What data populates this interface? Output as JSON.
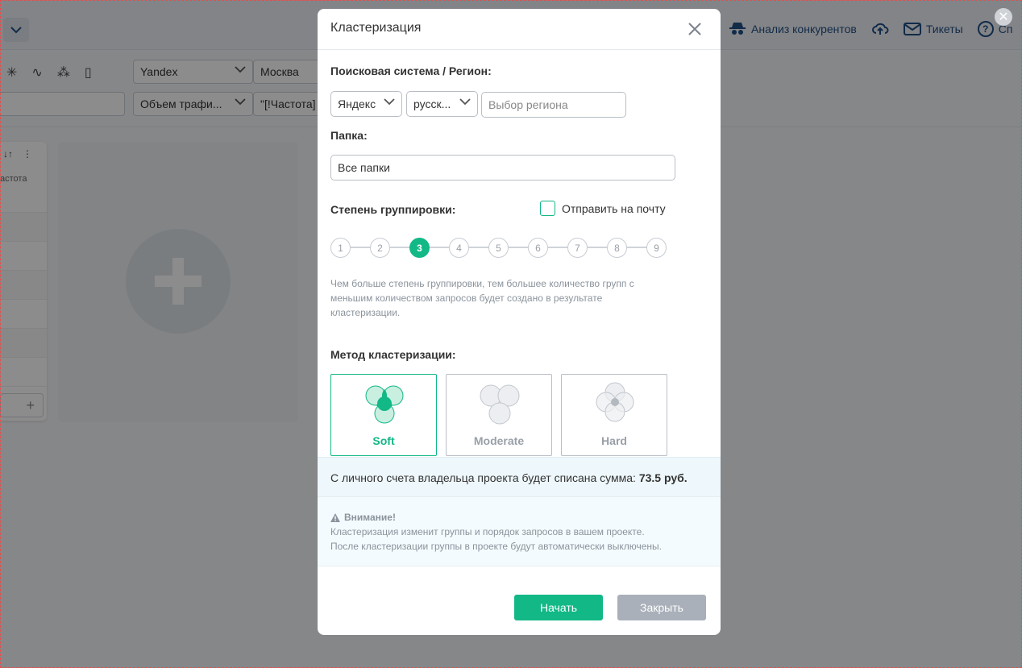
{
  "background": {
    "top_links": [
      {
        "label": "Анализ конкурентов",
        "icon": "spy-icon"
      },
      {
        "label": "",
        "icon": "cloud-upload-icon"
      },
      {
        "label": "Тикеты",
        "icon": "mail-icon"
      },
      {
        "label": "Сп",
        "icon": "help-icon"
      }
    ],
    "search_engine": "Yandex",
    "region": "Москва",
    "traffic": "Объем трафи...",
    "frequency": "\"[!Частота]",
    "column_header": "астота"
  },
  "modal": {
    "title": "Кластеризация",
    "search_label": "Поисковая система / Регион:",
    "engine_value": "Яндекс",
    "language_value": "русск...",
    "region_placeholder": "Выбор региона",
    "folder_label": "Папка:",
    "folder_value": "Все папки",
    "grouping_label": "Степень группировки:",
    "email_label": "Отправить на почту",
    "email_checked": false,
    "steps": [
      "1",
      "2",
      "3",
      "4",
      "5",
      "6",
      "7",
      "8",
      "9"
    ],
    "selected_step": 3,
    "hint": "Чем больше степень группировки, тем большее количество групп с меньшим количеством запросов будет создано в результате кластеризации.",
    "method_label": "Метод кластеризации:",
    "methods": [
      {
        "label": "Soft",
        "selected": true
      },
      {
        "label": "Moderate",
        "selected": false
      },
      {
        "label": "Hard",
        "selected": false
      }
    ],
    "cost_text": "С личного счета владельца проекта будет списана сумма:",
    "cost_value": "73.5 руб.",
    "warning_title": "Внимание!",
    "warning_line1": "Кластеризация изменит группы и порядок запросов в вашем проекте.",
    "warning_line2": "После кластеризации группы в проекте будут автоматически выключены.",
    "start_button": "Начать",
    "close_button": "Закрыть"
  },
  "colors": {
    "accent": "#12b886",
    "overlay": "rgba(0,0,0,0.45)",
    "disabled_button": "#a9b0b9"
  }
}
